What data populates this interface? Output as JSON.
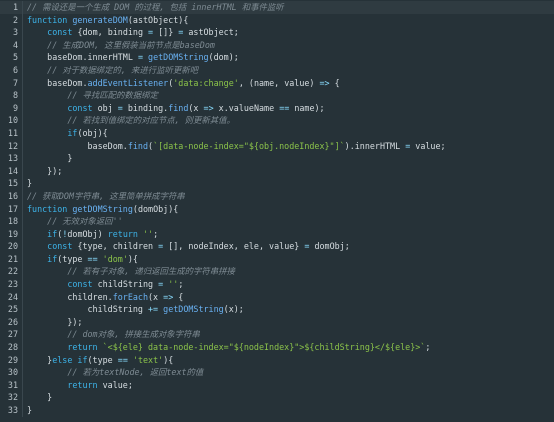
{
  "colors": {
    "background": "#263238",
    "keyword": "#3db3e8",
    "comment": "#7e8b93",
    "function": "#69b1f2",
    "string": "#8bc34a",
    "operator": "#89ddff",
    "text": "#d6dde1",
    "line_number": "#b8c2c8"
  },
  "editor": {
    "active_line": 1,
    "lines": [
      {
        "num": "1",
        "tokens": [
          {
            "t": "cmt",
            "v": "// 需设还是一个生成 DOM 的过程, 包括 innerHTML 和事件监听"
          }
        ]
      },
      {
        "num": "2",
        "tokens": [
          {
            "t": "kw",
            "v": "function "
          },
          {
            "t": "fn",
            "v": "generateDOM"
          },
          {
            "t": "plain",
            "v": "(astObject){"
          }
        ]
      },
      {
        "num": "3",
        "tokens": [
          {
            "t": "plain",
            "v": "    "
          },
          {
            "t": "kw",
            "v": "const "
          },
          {
            "t": "plain",
            "v": "{dom, binding "
          },
          {
            "t": "op",
            "v": "= "
          },
          {
            "t": "plain",
            "v": "[]} "
          },
          {
            "t": "op",
            "v": "= "
          },
          {
            "t": "plain",
            "v": "astObject;"
          }
        ]
      },
      {
        "num": "4",
        "tokens": [
          {
            "t": "plain",
            "v": "    "
          },
          {
            "t": "cmt",
            "v": "// 生成DOM, 这里假装当前节点是baseDom"
          }
        ]
      },
      {
        "num": "5",
        "tokens": [
          {
            "t": "plain",
            "v": "    baseDom.innerHTML "
          },
          {
            "t": "op",
            "v": "= "
          },
          {
            "t": "fn",
            "v": "getDOMString"
          },
          {
            "t": "plain",
            "v": "(dom);"
          }
        ]
      },
      {
        "num": "6",
        "tokens": [
          {
            "t": "plain",
            "v": "    "
          },
          {
            "t": "cmt",
            "v": "// 对于数据绑定的, 来进行监听更新吧"
          }
        ]
      },
      {
        "num": "7",
        "tokens": [
          {
            "t": "plain",
            "v": "    baseDom."
          },
          {
            "t": "fn",
            "v": "addEventListener"
          },
          {
            "t": "plain",
            "v": "("
          },
          {
            "t": "str",
            "v": "'data:change'"
          },
          {
            "t": "plain",
            "v": ", (name, value) "
          },
          {
            "t": "op",
            "v": "=> "
          },
          {
            "t": "plain",
            "v": "{"
          }
        ]
      },
      {
        "num": "8",
        "tokens": [
          {
            "t": "plain",
            "v": "        "
          },
          {
            "t": "cmt",
            "v": "// 寻找匹配的数据绑定"
          }
        ]
      },
      {
        "num": "9",
        "tokens": [
          {
            "t": "plain",
            "v": "        "
          },
          {
            "t": "kw",
            "v": "const "
          },
          {
            "t": "plain",
            "v": "obj "
          },
          {
            "t": "op",
            "v": "= "
          },
          {
            "t": "plain",
            "v": "binding."
          },
          {
            "t": "fn",
            "v": "find"
          },
          {
            "t": "plain",
            "v": "(x "
          },
          {
            "t": "op",
            "v": "=> "
          },
          {
            "t": "plain",
            "v": "x.valueName "
          },
          {
            "t": "op",
            "v": "== "
          },
          {
            "t": "plain",
            "v": "name);"
          }
        ]
      },
      {
        "num": "10",
        "tokens": [
          {
            "t": "plain",
            "v": "        "
          },
          {
            "t": "cmt",
            "v": "// 若找到值绑定的对应节点, 则更新其值。"
          }
        ]
      },
      {
        "num": "11",
        "tokens": [
          {
            "t": "plain",
            "v": "        "
          },
          {
            "t": "kw",
            "v": "if"
          },
          {
            "t": "plain",
            "v": "(obj){"
          }
        ]
      },
      {
        "num": "12",
        "tokens": [
          {
            "t": "plain",
            "v": "            baseDom."
          },
          {
            "t": "fn",
            "v": "find"
          },
          {
            "t": "plain",
            "v": "("
          },
          {
            "t": "str",
            "v": "`[data-node-index=\"${obj.nodeIndex}\"]`"
          },
          {
            "t": "plain",
            "v": ").innerHTML "
          },
          {
            "t": "op",
            "v": "= "
          },
          {
            "t": "plain",
            "v": "value;"
          }
        ]
      },
      {
        "num": "13",
        "tokens": [
          {
            "t": "plain",
            "v": "        }"
          }
        ]
      },
      {
        "num": "14",
        "tokens": [
          {
            "t": "plain",
            "v": "    });"
          }
        ]
      },
      {
        "num": "15",
        "tokens": [
          {
            "t": "plain",
            "v": "}"
          }
        ]
      },
      {
        "num": "16",
        "tokens": [
          {
            "t": "cmt",
            "v": "// 获取DOM字符串, 这里简单拼成字符串"
          }
        ]
      },
      {
        "num": "17",
        "tokens": [
          {
            "t": "kw",
            "v": "function "
          },
          {
            "t": "fn",
            "v": "getDOMString"
          },
          {
            "t": "plain",
            "v": "(domObj){"
          }
        ]
      },
      {
        "num": "18",
        "tokens": [
          {
            "t": "plain",
            "v": "    "
          },
          {
            "t": "cmt",
            "v": "// 无效对象返回''"
          }
        ]
      },
      {
        "num": "19",
        "tokens": [
          {
            "t": "plain",
            "v": "    "
          },
          {
            "t": "kw",
            "v": "if"
          },
          {
            "t": "plain",
            "v": "("
          },
          {
            "t": "op",
            "v": "!"
          },
          {
            "t": "plain",
            "v": "domObj) "
          },
          {
            "t": "kw",
            "v": "return "
          },
          {
            "t": "str",
            "v": "''"
          },
          {
            "t": "plain",
            "v": ";"
          }
        ]
      },
      {
        "num": "20",
        "tokens": [
          {
            "t": "plain",
            "v": "    "
          },
          {
            "t": "kw",
            "v": "const "
          },
          {
            "t": "plain",
            "v": "{type, children "
          },
          {
            "t": "op",
            "v": "= "
          },
          {
            "t": "plain",
            "v": "[], nodeIndex, ele, value} "
          },
          {
            "t": "op",
            "v": "= "
          },
          {
            "t": "plain",
            "v": "domObj;"
          }
        ]
      },
      {
        "num": "21",
        "tokens": [
          {
            "t": "plain",
            "v": "    "
          },
          {
            "t": "kw",
            "v": "if"
          },
          {
            "t": "plain",
            "v": "(type "
          },
          {
            "t": "op",
            "v": "== "
          },
          {
            "t": "str",
            "v": "'dom'"
          },
          {
            "t": "plain",
            "v": "){"
          }
        ]
      },
      {
        "num": "22",
        "tokens": [
          {
            "t": "plain",
            "v": "        "
          },
          {
            "t": "cmt",
            "v": "// 若有子对象, 递归返回生成的字符串拼接"
          }
        ]
      },
      {
        "num": "23",
        "tokens": [
          {
            "t": "plain",
            "v": "        "
          },
          {
            "t": "kw",
            "v": "const "
          },
          {
            "t": "plain",
            "v": "childString "
          },
          {
            "t": "op",
            "v": "= "
          },
          {
            "t": "str",
            "v": "''"
          },
          {
            "t": "plain",
            "v": ";"
          }
        ]
      },
      {
        "num": "24",
        "tokens": [
          {
            "t": "plain",
            "v": "        children."
          },
          {
            "t": "fn",
            "v": "forEach"
          },
          {
            "t": "plain",
            "v": "(x "
          },
          {
            "t": "op",
            "v": "=> "
          },
          {
            "t": "plain",
            "v": "{"
          }
        ]
      },
      {
        "num": "25",
        "tokens": [
          {
            "t": "plain",
            "v": "            childString "
          },
          {
            "t": "op",
            "v": "+= "
          },
          {
            "t": "fn",
            "v": "getDOMString"
          },
          {
            "t": "plain",
            "v": "(x);"
          }
        ]
      },
      {
        "num": "26",
        "tokens": [
          {
            "t": "plain",
            "v": "        });"
          }
        ]
      },
      {
        "num": "27",
        "tokens": [
          {
            "t": "plain",
            "v": "        "
          },
          {
            "t": "cmt",
            "v": "// dom对象, 拼接生成对象字符串"
          }
        ]
      },
      {
        "num": "28",
        "tokens": [
          {
            "t": "plain",
            "v": "        "
          },
          {
            "t": "kw",
            "v": "return "
          },
          {
            "t": "str",
            "v": "`<${ele} data-node-index=\"${nodeIndex}\">${childString}</${ele}>`"
          },
          {
            "t": "plain",
            "v": ";"
          }
        ]
      },
      {
        "num": "29",
        "tokens": [
          {
            "t": "plain",
            "v": "    }"
          },
          {
            "t": "kw",
            "v": "else if"
          },
          {
            "t": "plain",
            "v": "(type "
          },
          {
            "t": "op",
            "v": "== "
          },
          {
            "t": "str",
            "v": "'text'"
          },
          {
            "t": "plain",
            "v": "){"
          }
        ]
      },
      {
        "num": "30",
        "tokens": [
          {
            "t": "plain",
            "v": "        "
          },
          {
            "t": "cmt",
            "v": "// 若为textNode, 返回text的值"
          }
        ]
      },
      {
        "num": "31",
        "tokens": [
          {
            "t": "plain",
            "v": "        "
          },
          {
            "t": "kw",
            "v": "return "
          },
          {
            "t": "plain",
            "v": "value;"
          }
        ]
      },
      {
        "num": "32",
        "tokens": [
          {
            "t": "plain",
            "v": "    }"
          }
        ]
      },
      {
        "num": "33",
        "tokens": [
          {
            "t": "plain",
            "v": "}"
          }
        ]
      }
    ]
  }
}
